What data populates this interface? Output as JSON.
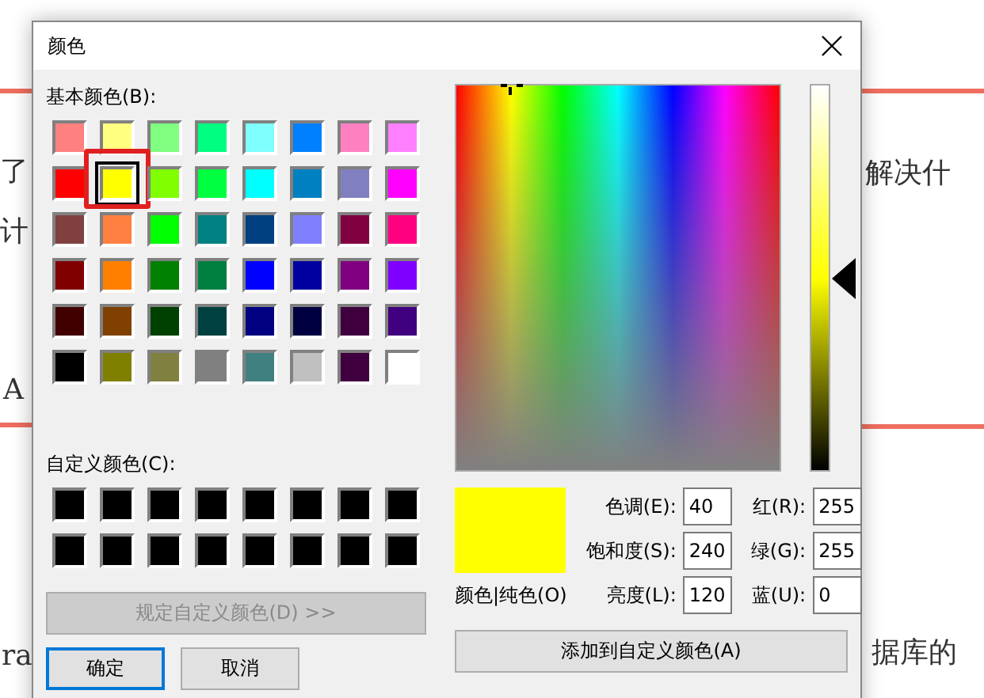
{
  "background_page": {
    "fragments": [
      "了",
      "计",
      "A",
      "ra",
      "解决什",
      "据库的"
    ]
  },
  "dialog": {
    "title": "颜色",
    "basic_colors": {
      "label": "基本颜色(B):",
      "swatches": [
        {
          "color": "#ff8080",
          "selected": false
        },
        {
          "color": "#ffff80",
          "selected": false
        },
        {
          "color": "#80ff80",
          "selected": false
        },
        {
          "color": "#00ff80",
          "selected": false
        },
        {
          "color": "#80ffff",
          "selected": false
        },
        {
          "color": "#0080ff",
          "selected": false
        },
        {
          "color": "#ff80c0",
          "selected": false
        },
        {
          "color": "#ff80ff",
          "selected": false
        },
        {
          "color": "#ff0000",
          "selected": false
        },
        {
          "color": "#ffff00",
          "selected": true
        },
        {
          "color": "#80ff00",
          "selected": false
        },
        {
          "color": "#00ff40",
          "selected": false
        },
        {
          "color": "#00ffff",
          "selected": false
        },
        {
          "color": "#0080c0",
          "selected": false
        },
        {
          "color": "#8080c0",
          "selected": false
        },
        {
          "color": "#ff00ff",
          "selected": false
        },
        {
          "color": "#804040",
          "selected": false
        },
        {
          "color": "#ff8040",
          "selected": false
        },
        {
          "color": "#00ff00",
          "selected": false
        },
        {
          "color": "#008080",
          "selected": false
        },
        {
          "color": "#004080",
          "selected": false
        },
        {
          "color": "#8080ff",
          "selected": false
        },
        {
          "color": "#800040",
          "selected": false
        },
        {
          "color": "#ff0080",
          "selected": false
        },
        {
          "color": "#800000",
          "selected": false
        },
        {
          "color": "#ff8000",
          "selected": false
        },
        {
          "color": "#008000",
          "selected": false
        },
        {
          "color": "#008040",
          "selected": false
        },
        {
          "color": "#0000ff",
          "selected": false
        },
        {
          "color": "#0000a0",
          "selected": false
        },
        {
          "color": "#800080",
          "selected": false
        },
        {
          "color": "#8000ff",
          "selected": false
        },
        {
          "color": "#400000",
          "selected": false
        },
        {
          "color": "#804000",
          "selected": false
        },
        {
          "color": "#004000",
          "selected": false
        },
        {
          "color": "#004040",
          "selected": false
        },
        {
          "color": "#000080",
          "selected": false
        },
        {
          "color": "#000040",
          "selected": false
        },
        {
          "color": "#400040",
          "selected": false
        },
        {
          "color": "#400080",
          "selected": false
        },
        {
          "color": "#000000",
          "selected": false
        },
        {
          "color": "#808000",
          "selected": false
        },
        {
          "color": "#808040",
          "selected": false
        },
        {
          "color": "#808080",
          "selected": false
        },
        {
          "color": "#408080",
          "selected": false
        },
        {
          "color": "#c0c0c0",
          "selected": false
        },
        {
          "color": "#400040",
          "selected": false
        },
        {
          "color": "#ffffff",
          "selected": false
        }
      ]
    },
    "custom_colors": {
      "label": "自定义颜色(C):",
      "swatches": [
        {
          "color": "#000000",
          "selected": false
        },
        {
          "color": "#000000",
          "selected": false
        },
        {
          "color": "#000000",
          "selected": false
        },
        {
          "color": "#000000",
          "selected": false
        },
        {
          "color": "#000000",
          "selected": false
        },
        {
          "color": "#000000",
          "selected": false
        },
        {
          "color": "#000000",
          "selected": false
        },
        {
          "color": "#000000",
          "selected": false
        },
        {
          "color": "#000000",
          "selected": false
        },
        {
          "color": "#000000",
          "selected": false
        },
        {
          "color": "#000000",
          "selected": false
        },
        {
          "color": "#000000",
          "selected": false
        },
        {
          "color": "#000000",
          "selected": false
        },
        {
          "color": "#000000",
          "selected": false
        },
        {
          "color": "#000000",
          "selected": false
        },
        {
          "color": "#000000",
          "selected": false
        }
      ]
    },
    "define_button": {
      "label": "规定自定义颜色(D) >>",
      "disabled": true
    },
    "ok_button": "确定",
    "cancel_button": "取消",
    "luminance": {
      "level": 0.5
    },
    "preview": {
      "color": "#ffff00",
      "label": "颜色|纯色(O)"
    },
    "fields": [
      {
        "label": "色调(E):",
        "value": "40"
      },
      {
        "label": "红(R):",
        "value": "255"
      },
      {
        "label": "饱和度(S):",
        "value": "240"
      },
      {
        "label": "绿(G):",
        "value": "255"
      },
      {
        "label": "亮度(L):",
        "value": "120"
      },
      {
        "label": "蓝(U):",
        "value": "0"
      }
    ],
    "add_button": "添加到自定义颜色(A)"
  }
}
